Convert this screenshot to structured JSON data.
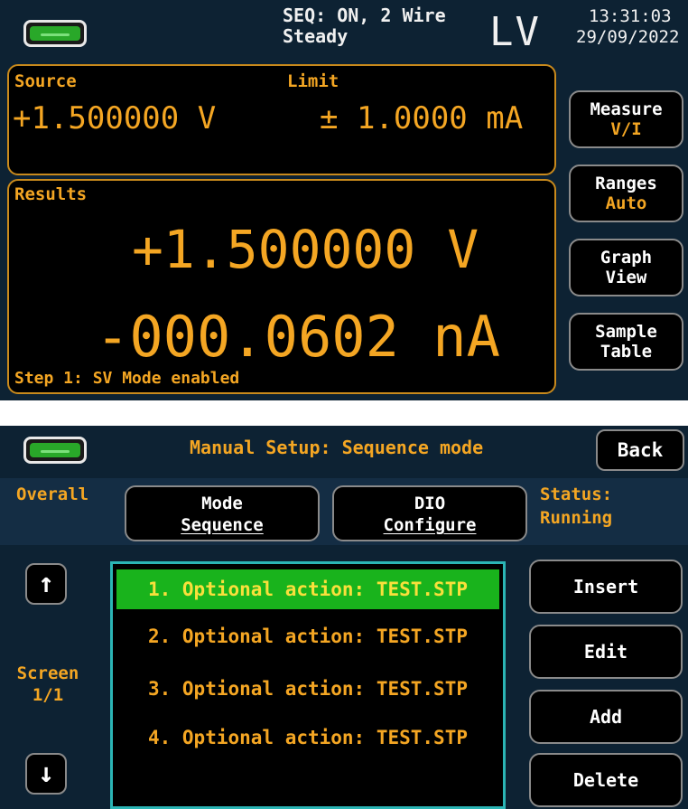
{
  "top": {
    "status": {
      "seq_line1": "SEQ: ON, 2 Wire",
      "seq_line2": "Steady",
      "mode": "LV",
      "time": "13:31:03",
      "date": "29/09/2022",
      "battery_icon": "battery-icon"
    },
    "source_panel": {
      "source_label": "Source",
      "limit_label": "Limit",
      "source_value": "+1.500000 V",
      "limit_value": "± 1.0000 mA"
    },
    "results_panel": {
      "label": "Results",
      "voltage": "+1.500000 V",
      "current": "-000.0602 nA",
      "step_text": "Step 1: SV Mode enabled"
    },
    "side_buttons": [
      {
        "line1": "Measure",
        "line2": "V/I"
      },
      {
        "line1": "Ranges",
        "line2": "Auto"
      },
      {
        "line1": "Graph",
        "line2": "View"
      },
      {
        "line1": "Sample",
        "line2": "Table"
      }
    ]
  },
  "bottom": {
    "title": "Manual Setup: Sequence mode",
    "back_label": "Back",
    "overall_label": "Overall",
    "mode_button": {
      "line1": "Mode",
      "line2": "Sequence"
    },
    "dio_button": {
      "line1": "DIO",
      "line2": "Configure"
    },
    "status_label": "Status:",
    "status_value": "Running",
    "screen_label": "Screen",
    "screen_page": "1/1",
    "up_arrow": "↑",
    "down_arrow": "↓",
    "sequence_items": [
      "1. Optional action: TEST.STP",
      "2. Optional action: TEST.STP",
      "3. Optional action: TEST.STP",
      "4. Optional action: TEST.STP"
    ],
    "selected_index": 0,
    "actions": {
      "insert": "Insert",
      "edit": "Edit",
      "add": "Add",
      "delete": "Delete"
    }
  },
  "colors": {
    "background": "#0d2233",
    "accent_orange": "#f4a623",
    "selection_green": "#19b31c",
    "list_border": "#2bb5b5"
  }
}
